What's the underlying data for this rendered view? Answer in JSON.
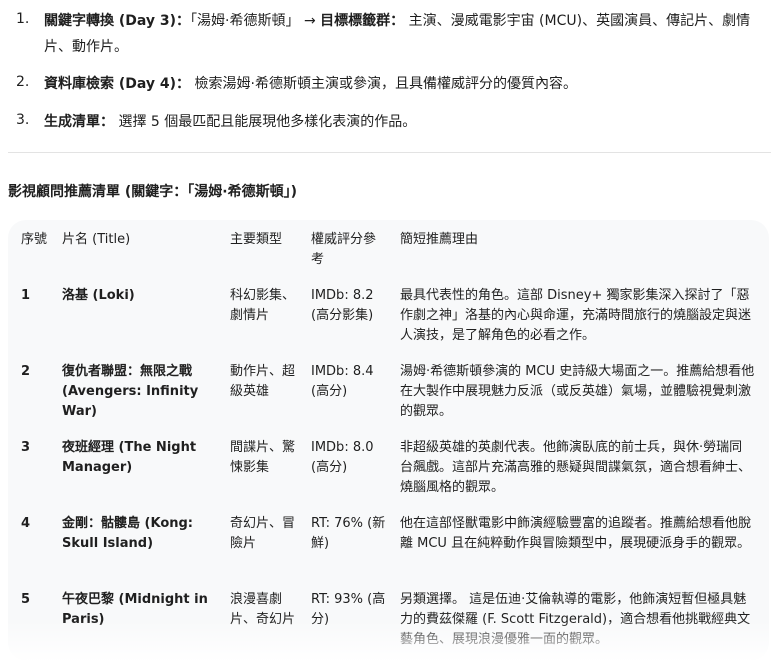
{
  "steps": [
    {
      "num": "1.",
      "title": "關鍵字轉換 (Day 3)：",
      "text": "「湯姆·希德斯頓」 → ",
      "title2": "目標標籤群：",
      "text2": " 主演、漫威電影宇宙 (MCU)、英國演員、傳記片、劇情片、動作片。"
    },
    {
      "num": "2.",
      "title": "資料庫檢索 (Day 4)：",
      "text": " 檢索湯姆·希德斯頓主演或參演，且具備權威評分的優質內容。"
    },
    {
      "num": "3.",
      "title": "生成清單：",
      "text": " 選擇 5 個最匹配且能展現他多樣化表演的作品。"
    }
  ],
  "section_title": "影視顧問推薦清單 (關鍵字：「湯姆·希德斯頓」)",
  "table": {
    "headers": [
      "序號",
      "片名 (Title)",
      "主要類型",
      "權威評分參考",
      "簡短推薦理由"
    ],
    "rows": [
      {
        "idx": "1",
        "title": "洛基 (Loki)",
        "genre": "科幻影集、劇情片",
        "rating": "IMDb: 8.2 (高分影集)",
        "reason": "最具代表性的角色。這部 Disney+ 獨家影集深入探討了「惡作劇之神」洛基的內心與命運，充滿時間旅行的燒腦設定與迷人演技，是了解角色的必看之作。"
      },
      {
        "idx": "2",
        "title": "復仇者聯盟：無限之戰 (Avengers: Infinity War)",
        "genre": "動作片、超級英雄",
        "rating": "IMDb: 8.4 (高分)",
        "reason": "湯姆·希德斯頓參演的 MCU 史詩級大場面之一。推薦給想看他在大製作中展現魅力反派（或反英雄）氣場，並體驗視覺刺激的觀眾。"
      },
      {
        "idx": "3",
        "title": "夜班經理 (The Night Manager)",
        "genre": "間諜片、驚悚影集",
        "rating": "IMDb: 8.0 (高分)",
        "reason": "非超級英雄的英劇代表。他飾演臥底的前士兵，與休·勞瑞同台飆戲。這部片充滿高雅的懸疑與間諜氣氛，適合想看紳士、燒腦風格的觀眾。"
      },
      {
        "idx": "4",
        "title": "金剛：骷髏島 (Kong: Skull Island)",
        "genre": "奇幻片、冒險片",
        "rating": "RT: 76% (新鮮)",
        "reason": "他在這部怪獸電影中飾演經驗豐富的追蹤者。推薦給想看他脫離 MCU 且在純粹動作與冒險類型中，展現硬派身手的觀眾。"
      },
      {
        "idx": "5",
        "title": "午夜巴黎 (Midnight in Paris)",
        "genre": "浪漫喜劇片、奇幻片",
        "rating": "RT: 93% (高分)",
        "reason": "另類選擇。 這是伍迪·艾倫執導的電影，他飾演短暫但極具魅力的費茲傑羅 (F. Scott Fitzgerald)，適合想看他挑戰經典文藝角色、展現浪漫優雅一面的觀眾。"
      }
    ]
  }
}
